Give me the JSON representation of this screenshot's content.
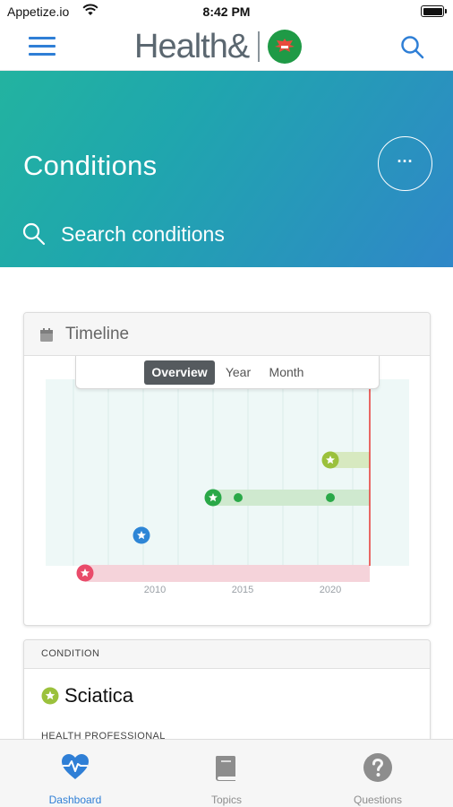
{
  "status_bar": {
    "carrier": "Appetize.io",
    "time": "8:42 PM"
  },
  "header": {
    "logo_text": "Health&",
    "icons": [
      "menu-icon",
      "brand-badge-icon",
      "search-icon"
    ]
  },
  "hero": {
    "title": "Conditions",
    "more_label": "···",
    "search_placeholder": "Search conditions"
  },
  "timeline": {
    "title": "Timeline",
    "views": [
      {
        "label": "Overview",
        "active": true
      },
      {
        "label": "Year",
        "active": false
      },
      {
        "label": "Month",
        "active": false
      }
    ],
    "axis_ticks": [
      "2010",
      "2015",
      "2020"
    ],
    "colors": {
      "green_light": "#9bc13c",
      "green": "#2aa848",
      "blue": "#2e86d6",
      "red": "#e94b6a",
      "today_line": "#e53935"
    }
  },
  "condition_card": {
    "header": "CONDITION",
    "name": "Sciatica",
    "subheader": "HEALTH PROFESSIONAL"
  },
  "tabs": [
    {
      "label": "Dashboard",
      "icon": "heart-pulse-icon",
      "active": true
    },
    {
      "label": "Topics",
      "icon": "book-icon",
      "active": false
    },
    {
      "label": "Questions",
      "icon": "question-icon",
      "active": false
    }
  ]
}
